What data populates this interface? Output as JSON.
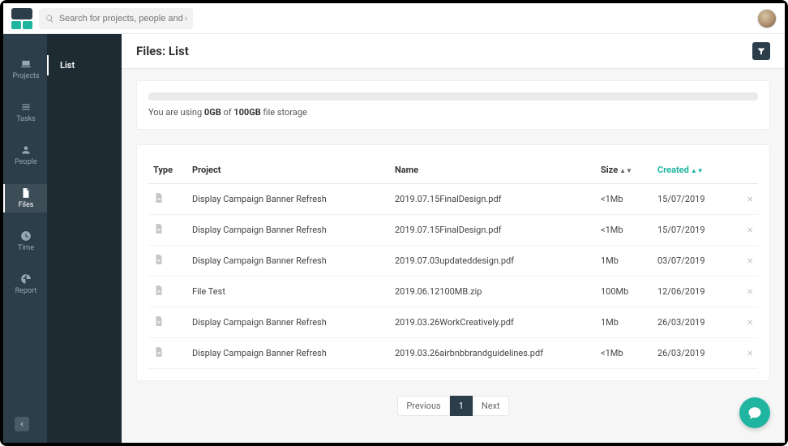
{
  "search": {
    "placeholder": "Search for projects, people and companies"
  },
  "rail": [
    {
      "icon": "laptop",
      "label": "Projects"
    },
    {
      "icon": "list",
      "label": "Tasks"
    },
    {
      "icon": "user",
      "label": "People"
    },
    {
      "icon": "file",
      "label": "Files",
      "active": true
    },
    {
      "icon": "clock",
      "label": "Time"
    },
    {
      "icon": "chart",
      "label": "Report"
    }
  ],
  "subnav": {
    "item": "List"
  },
  "page": {
    "title": "Files: List"
  },
  "storage": {
    "prefix": "You are using ",
    "used": "0GB",
    "mid": " of ",
    "total": "100GB",
    "suffix": " file storage"
  },
  "columns": {
    "type": "Type",
    "project": "Project",
    "name": "Name",
    "size": "Size",
    "created": "Created",
    "actions": ""
  },
  "files": [
    {
      "project": "Display Campaign Banner Refresh",
      "name": "2019.07.15FinalDesign.pdf",
      "size": "<1Mb",
      "created": "15/07/2019"
    },
    {
      "project": "Display Campaign Banner Refresh",
      "name": "2019.07.15FinalDesign.pdf",
      "size": "<1Mb",
      "created": "15/07/2019"
    },
    {
      "project": "Display Campaign Banner Refresh",
      "name": "2019.07.03updateddesign.pdf",
      "size": "1Mb",
      "created": "03/07/2019"
    },
    {
      "project": "File Test",
      "name": "2019.06.12100MB.zip",
      "size": "100Mb",
      "created": "12/06/2019"
    },
    {
      "project": "Display Campaign Banner Refresh",
      "name": "2019.03.26WorkCreatively.pdf",
      "size": "1Mb",
      "created": "26/03/2019"
    },
    {
      "project": "Display Campaign Banner Refresh",
      "name": "2019.03.26airbnbbrandguidelines.pdf",
      "size": "<1Mb",
      "created": "26/03/2019"
    }
  ],
  "pager": {
    "prev": "Previous",
    "current": "1",
    "next": "Next"
  }
}
